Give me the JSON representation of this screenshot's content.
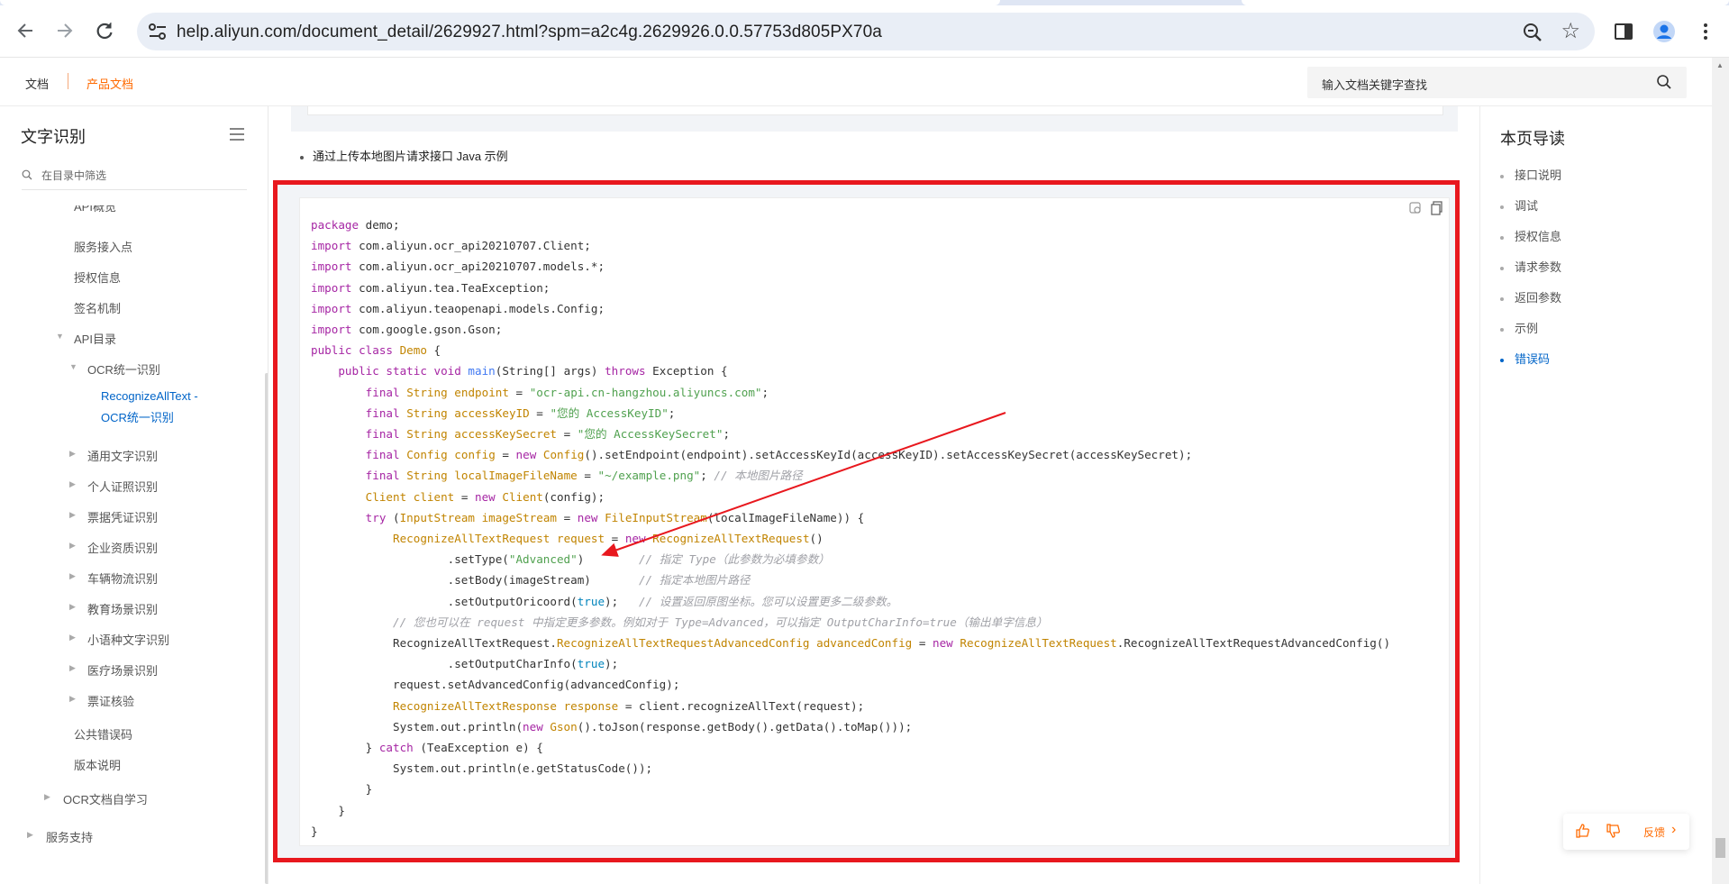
{
  "browser": {
    "url": "help.aliyun.com/document_detail/2629927.html?spm=a2c4g.2629926.0.0.57753d805PX70a"
  },
  "header": {
    "doc_link": "文档",
    "product_link": "产品文档",
    "search_placeholder": "输入文档关键字查找"
  },
  "sidebar": {
    "title": "文字识别",
    "filter_placeholder": "在目录中筛选",
    "items": {
      "api_overview": "API概览",
      "endpoint": "服务接入点",
      "auth": "授权信息",
      "signature": "签名机制",
      "api_dir": "API目录",
      "ocr_unified": "OCR统一识别",
      "recognize_all_line1": "RecognizeAllText -",
      "recognize_all_line2": "OCR统一识别",
      "general_text": "通用文字识别",
      "id_cards": "个人证照识别",
      "receipts": "票据凭证识别",
      "enterprise": "企业资质识别",
      "vehicle": "车辆物流识别",
      "education": "教育场景识别",
      "minor_lang": "小语种文字识别",
      "medical": "医疗场景识别",
      "verification": "票证核验",
      "public_errors": "公共错误码",
      "version_notes": "版本说明",
      "ocr_self_study": "OCR文档自学习",
      "service_support": "服务支持"
    }
  },
  "content": {
    "bullet_text": "通过上传本地图片请求接口 Java 示例",
    "code_lines": [
      [
        [
          "kw",
          "package"
        ],
        [
          "pl",
          " demo;"
        ]
      ],
      [
        [
          "kw",
          "import"
        ],
        [
          "pl",
          " com.aliyun.ocr_api20210707.Client;"
        ]
      ],
      [
        [
          "kw",
          "import"
        ],
        [
          "pl",
          " com.aliyun.ocr_api20210707.models.*;"
        ]
      ],
      [
        [
          "kw",
          "import"
        ],
        [
          "pl",
          " com.aliyun.tea.TeaException;"
        ]
      ],
      [
        [
          "kw",
          "import"
        ],
        [
          "pl",
          " com.aliyun.teaopenapi.models.Config;"
        ]
      ],
      [
        [
          "kw",
          "import"
        ],
        [
          "pl",
          " com.google.gson.Gson;"
        ]
      ],
      [
        [
          "kw",
          "public class"
        ],
        [
          "pl",
          " "
        ],
        [
          "ty",
          "Demo"
        ],
        [
          "pl",
          " {"
        ]
      ],
      [
        [
          "pl",
          "    "
        ],
        [
          "kw",
          "public static void"
        ],
        [
          "pl",
          " "
        ],
        [
          "fn",
          "main"
        ],
        [
          "pl",
          "(String[] args) "
        ],
        [
          "kw",
          "throws"
        ],
        [
          "pl",
          " Exception {"
        ]
      ],
      [
        [
          "pl",
          "        "
        ],
        [
          "kw",
          "final"
        ],
        [
          "pl",
          " "
        ],
        [
          "ty",
          "String"
        ],
        [
          "pl",
          " "
        ],
        [
          "ty",
          "endpoint"
        ],
        [
          "pl",
          " = "
        ],
        [
          "st",
          "\"ocr-api.cn-hangzhou.aliyuncs.com\""
        ],
        [
          "pl",
          ";"
        ]
      ],
      [
        [
          "pl",
          "        "
        ],
        [
          "kw",
          "final"
        ],
        [
          "pl",
          " "
        ],
        [
          "ty",
          "String"
        ],
        [
          "pl",
          " "
        ],
        [
          "ty",
          "accessKeyID"
        ],
        [
          "pl",
          " = "
        ],
        [
          "st",
          "\"您的 AccessKeyID\""
        ],
        [
          "pl",
          ";"
        ]
      ],
      [
        [
          "pl",
          "        "
        ],
        [
          "kw",
          "final"
        ],
        [
          "pl",
          " "
        ],
        [
          "ty",
          "String"
        ],
        [
          "pl",
          " "
        ],
        [
          "ty",
          "accessKeySecret"
        ],
        [
          "pl",
          " = "
        ],
        [
          "st",
          "\"您的 AccessKeySecret\""
        ],
        [
          "pl",
          ";"
        ]
      ],
      [
        [
          "pl",
          "        "
        ],
        [
          "kw",
          "final"
        ],
        [
          "pl",
          " "
        ],
        [
          "ty",
          "Config"
        ],
        [
          "pl",
          " "
        ],
        [
          "ty",
          "config"
        ],
        [
          "pl",
          " = "
        ],
        [
          "kw",
          "new"
        ],
        [
          "pl",
          " "
        ],
        [
          "ty",
          "Config"
        ],
        [
          "pl",
          "().setEndpoint(endpoint).setAccessKeyId(accessKeyID).setAccessKeySecret(accessKeySecret);"
        ]
      ],
      [
        [
          "pl",
          "        "
        ],
        [
          "kw",
          "final"
        ],
        [
          "pl",
          " "
        ],
        [
          "ty",
          "String"
        ],
        [
          "pl",
          " "
        ],
        [
          "ty",
          "localImageFileName"
        ],
        [
          "pl",
          " = "
        ],
        [
          "st",
          "\"~/example.png\""
        ],
        [
          "pl",
          "; "
        ],
        [
          "cm",
          "// 本地图片路径"
        ]
      ],
      [
        [
          "pl",
          "        "
        ],
        [
          "ty",
          "Client"
        ],
        [
          "pl",
          " "
        ],
        [
          "ty",
          "client"
        ],
        [
          "pl",
          " = "
        ],
        [
          "kw",
          "new"
        ],
        [
          "pl",
          " "
        ],
        [
          "ty",
          "Client"
        ],
        [
          "pl",
          "(config);"
        ]
      ],
      [
        [
          "pl",
          "        "
        ],
        [
          "kw",
          "try"
        ],
        [
          "pl",
          " ("
        ],
        [
          "ty",
          "InputStream"
        ],
        [
          "pl",
          " "
        ],
        [
          "ty",
          "imageStream"
        ],
        [
          "pl",
          " = "
        ],
        [
          "kw",
          "new"
        ],
        [
          "pl",
          " "
        ],
        [
          "ty",
          "FileInputStream"
        ],
        [
          "pl",
          "(localImageFileName)) {"
        ]
      ],
      [
        [
          "pl",
          "            "
        ],
        [
          "ty",
          "RecognizeAllTextRequest"
        ],
        [
          "pl",
          " "
        ],
        [
          "ty",
          "request"
        ],
        [
          "pl",
          " = "
        ],
        [
          "kw",
          "new"
        ],
        [
          "pl",
          " "
        ],
        [
          "ty",
          "RecognizeAllTextRequest"
        ],
        [
          "pl",
          "()"
        ]
      ],
      [
        [
          "pl",
          "                    .setType("
        ],
        [
          "st",
          "\"Advanced\""
        ],
        [
          "pl",
          ")        "
        ],
        [
          "cm",
          "// 指定 Type（此参数为必填参数）"
        ]
      ],
      [
        [
          "pl",
          "                    .setBody(imageStream)       "
        ],
        [
          "cm",
          "// 指定本地图片路径"
        ]
      ],
      [
        [
          "pl",
          "                    .setOutputOricoord("
        ],
        [
          "lit",
          "true"
        ],
        [
          "pl",
          ");   "
        ],
        [
          "cm",
          "// 设置返回原图坐标。您可以设置更多二级参数。"
        ]
      ],
      [
        [
          "pl",
          "            "
        ],
        [
          "cm",
          "// 您也可以在 request 中指定更多参数。例如对于 Type=Advanced，可以指定 OutputCharInfo=true（输出单字信息）"
        ]
      ],
      [
        [
          "pl",
          "            RecognizeAllTextRequest."
        ],
        [
          "ty",
          "RecognizeAllTextRequestAdvancedConfig"
        ],
        [
          "pl",
          " "
        ],
        [
          "ty",
          "advancedConfig"
        ],
        [
          "pl",
          " = "
        ],
        [
          "kw",
          "new"
        ],
        [
          "pl",
          " "
        ],
        [
          "ty",
          "RecognizeAllTextRequest"
        ],
        [
          "pl",
          ".RecognizeAllTextRequestAdvancedConfig()"
        ]
      ],
      [
        [
          "pl",
          "                    .setOutputCharInfo("
        ],
        [
          "lit",
          "true"
        ],
        [
          "pl",
          ");"
        ]
      ],
      [
        [
          "pl",
          "            request.setAdvancedConfig(advancedConfig);"
        ]
      ],
      [
        [
          "pl",
          "            "
        ],
        [
          "ty",
          "RecognizeAllTextResponse"
        ],
        [
          "pl",
          " "
        ],
        [
          "ty",
          "response"
        ],
        [
          "pl",
          " = client.recognizeAllText(request);"
        ]
      ],
      [
        [
          "pl",
          "            System.out.println("
        ],
        [
          "kw",
          "new"
        ],
        [
          "pl",
          " "
        ],
        [
          "ty",
          "Gson"
        ],
        [
          "pl",
          "().toJson(response.getBody().getData().toMap()));"
        ]
      ],
      [
        [
          "pl",
          "        } "
        ],
        [
          "kw",
          "catch"
        ],
        [
          "pl",
          " (TeaException e) {"
        ]
      ],
      [
        [
          "pl",
          "            System.out.println(e.getStatusCode());"
        ]
      ],
      [
        [
          "pl",
          "        }"
        ]
      ],
      [
        [
          "pl",
          "    }"
        ]
      ],
      [
        [
          "pl",
          "}"
        ]
      ]
    ]
  },
  "toc": {
    "title": "本页导读",
    "items": [
      "接口说明",
      "调试",
      "授权信息",
      "请求参数",
      "返回参数",
      "示例",
      "错误码"
    ],
    "active_index": 6
  },
  "feedback": {
    "label": "反馈"
  },
  "colors": {
    "accent_orange": "#ff6a00",
    "link_blue": "#0064c8",
    "highlight_red": "#e8181e"
  }
}
